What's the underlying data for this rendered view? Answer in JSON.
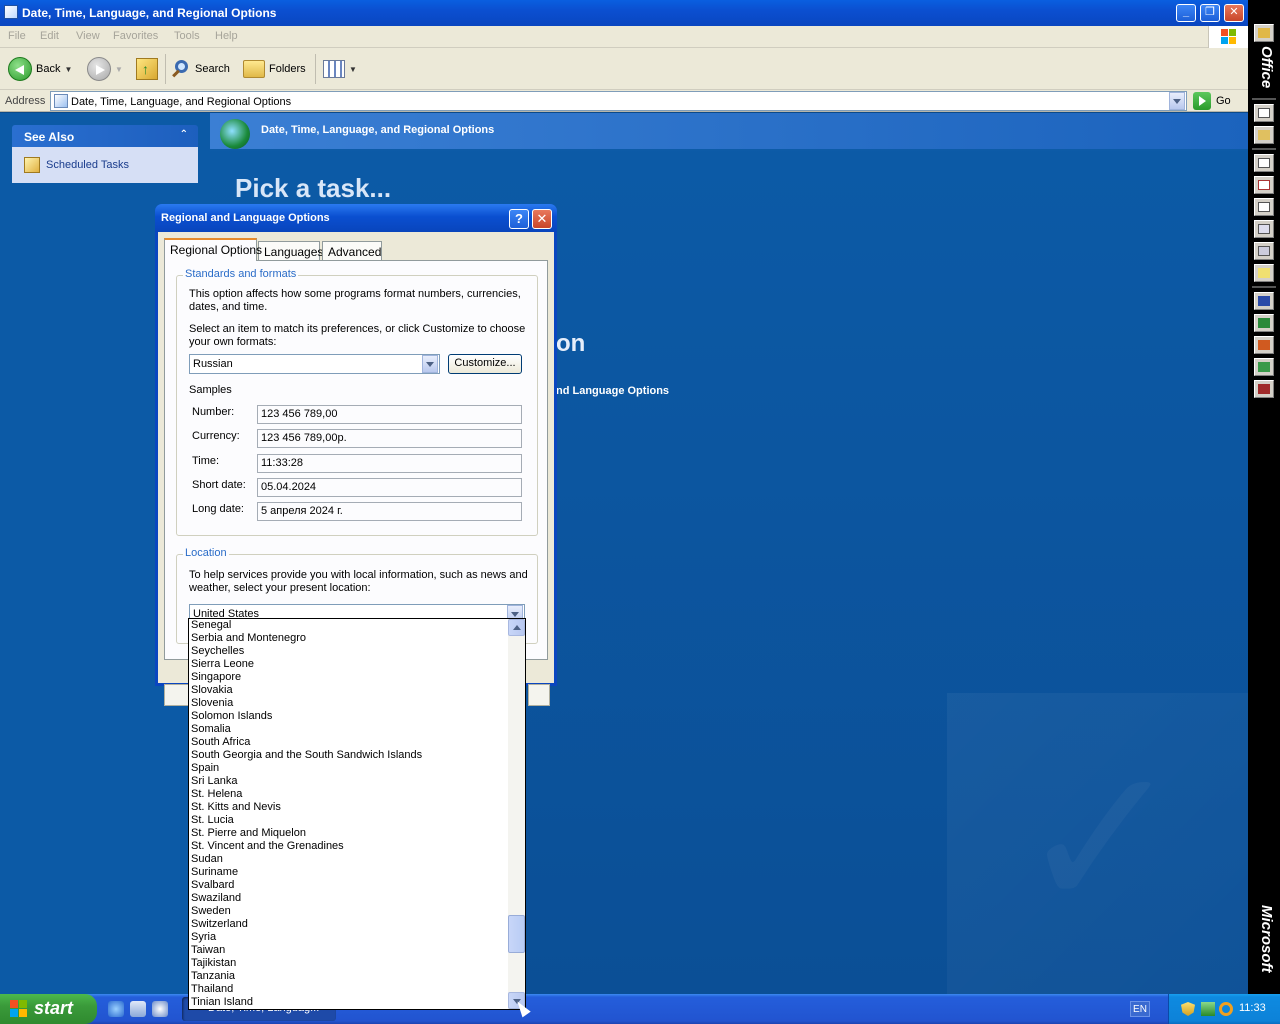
{
  "explorer": {
    "title": "Date, Time, Language, and Regional Options",
    "menu": [
      "File",
      "Edit",
      "View",
      "Favorites",
      "Tools",
      "Help"
    ],
    "toolbar": {
      "back_label": "Back",
      "search_label": "Search",
      "folders_label": "Folders"
    },
    "address": {
      "label": "Address",
      "value": "Date, Time, Language, and Regional Options",
      "go_label": "Go"
    },
    "see_also": {
      "header": "See Also",
      "items": [
        {
          "label": "Scheduled Tasks"
        }
      ]
    },
    "banner_title": "Date, Time, Language, and Regional Options",
    "pick_task": "Pick a task...",
    "partial_heading": "on",
    "partial_link": "nd Language Options"
  },
  "office_bar": {
    "top_label": "Office",
    "bottom_label": "Microsoft"
  },
  "dialog": {
    "title": "Regional and Language Options",
    "help_glyph": "?",
    "close_glyph": "✕",
    "tabs": [
      "Regional Options",
      "Languages",
      "Advanced"
    ],
    "standards": {
      "title": "Standards and formats",
      "description": "This option affects how some programs format numbers, currencies, dates, and time.",
      "select_prompt": "Select an item to match its preferences, or click Customize to choose your own formats:",
      "selected_format": "Russian",
      "customize_label": "Customize...",
      "samples_label": "Samples",
      "samples": [
        {
          "label": "Number:",
          "value": "123 456 789,00"
        },
        {
          "label": "Currency:",
          "value": "123 456 789,00р."
        },
        {
          "label": "Time:",
          "value": "11:33:28"
        },
        {
          "label": "Short date:",
          "value": "05.04.2024"
        },
        {
          "label": "Long date:",
          "value": "5 апреля 2024 г."
        }
      ]
    },
    "location": {
      "title": "Location",
      "description": "To help services provide you with local information, such as news and weather, select your present location:",
      "selected": "United States",
      "options": [
        "Senegal",
        "Serbia and Montenegro",
        "Seychelles",
        "Sierra Leone",
        "Singapore",
        "Slovakia",
        "Slovenia",
        "Solomon Islands",
        "Somalia",
        "South Africa",
        "South Georgia and the South Sandwich Islands",
        "Spain",
        "Sri Lanka",
        "St. Helena",
        "St. Kitts and Nevis",
        "St. Lucia",
        "St. Pierre and Miquelon",
        "St. Vincent and the Grenadines",
        "Sudan",
        "Suriname",
        "Svalbard",
        "Swaziland",
        "Sweden",
        "Switzerland",
        "Syria",
        "Taiwan",
        "Tajikistan",
        "Tanzania",
        "Thailand",
        "Tinian Island"
      ]
    }
  },
  "taskbar": {
    "start_label": "start",
    "task_label": "Date, Time, Languag...",
    "language": "EN",
    "clock": "11:33"
  }
}
